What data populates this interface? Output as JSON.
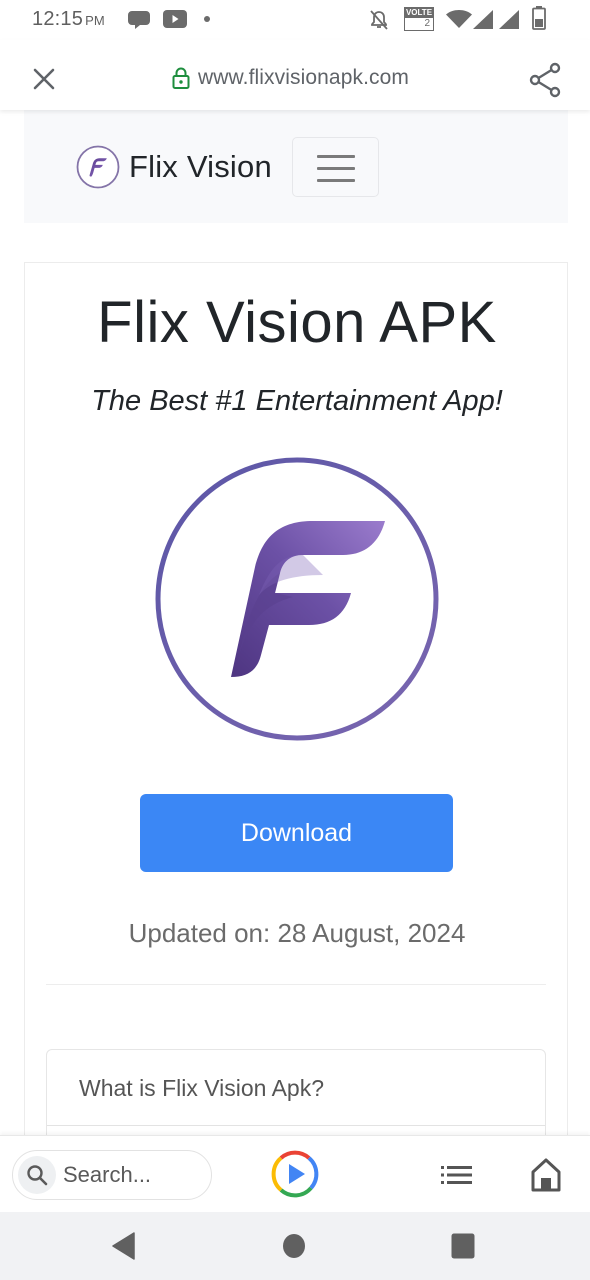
{
  "status_bar": {
    "time": "12:15",
    "ampm": "PM",
    "left_icons": [
      "messages-icon",
      "youtube-icon",
      "notification-dot-icon"
    ],
    "right_icons": [
      "bell-muted-icon",
      "volte-icon",
      "wifi-icon",
      "signal-icon",
      "signal-icon",
      "battery-icon"
    ],
    "volte_label": "VOLTE",
    "volte_sim": "2"
  },
  "browser": {
    "url": "www.flixvisionapk.com",
    "secure": true,
    "colors": {
      "lock": "#1e8e3e",
      "url_text": "#5f6368"
    }
  },
  "site": {
    "brand_name": "Flix Vision",
    "brand_color": "#6b4fa3",
    "hero": {
      "title": "Flix Vision APK",
      "subtitle": "The Best #1 Entertainment App!",
      "download_label": "Download",
      "updated_text": "Updated on: 28 August, 2024"
    },
    "toc": {
      "items": [
        "What is Flix Vision Apk?"
      ]
    },
    "colors": {
      "button": "#3b87f5",
      "nav_bg": "#f8f9fb"
    }
  },
  "bottom_bar": {
    "search_placeholder": "Search...",
    "icons": [
      "search-icon",
      "play-icon",
      "list-icon",
      "home-icon"
    ]
  },
  "system_nav": {
    "icons": [
      "back-icon",
      "home-circle-icon",
      "recents-icon"
    ]
  }
}
